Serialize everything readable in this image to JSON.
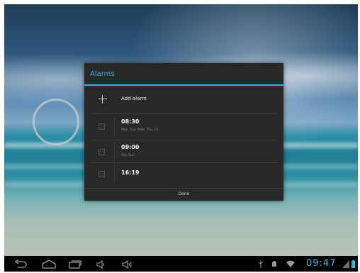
{
  "dialog": {
    "title": "Alarms",
    "add_label": "Add alarm",
    "done_label": "Done",
    "alarms": [
      {
        "time": "08:30",
        "days": "Mon, Tue, Wed, Thu, Fri",
        "enabled": false
      },
      {
        "time": "09:00",
        "days": "Sat, Sun",
        "enabled": false
      },
      {
        "time": "16:19",
        "days": "",
        "enabled": false
      }
    ]
  },
  "status_bar": {
    "time": "09:47"
  },
  "icons": {
    "back": "back-icon",
    "home": "home-icon",
    "recent": "recent-apps-icon",
    "vol_down": "volume-down-icon",
    "vol_up": "volume-up-icon",
    "usb": "usb-icon",
    "debug": "android-debug-icon",
    "wifi": "wifi-icon",
    "signal": "signal-icon",
    "battery": "battery-icon"
  },
  "colors": {
    "accent": "#33b5e5",
    "dialog_bg": "#282828",
    "navbar_bg": "#000000"
  }
}
